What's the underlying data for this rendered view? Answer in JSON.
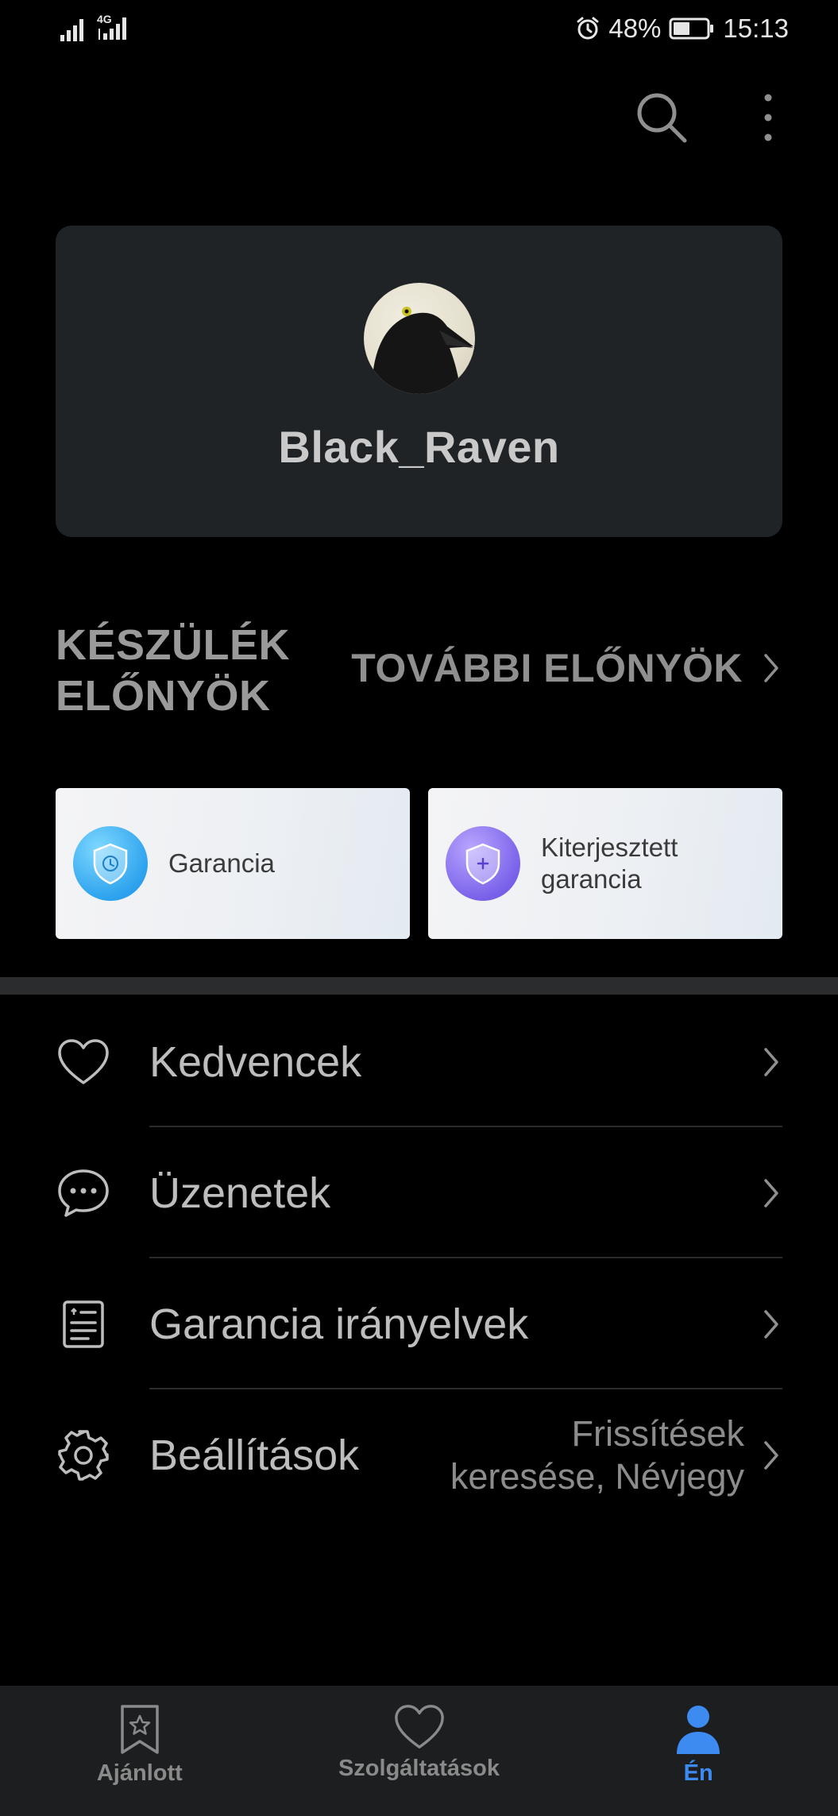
{
  "status_bar": {
    "network": "4G",
    "battery": "48%",
    "time": "15:13"
  },
  "top_actions": {
    "search_icon": "search-icon",
    "more_icon": "more-vertical-icon"
  },
  "profile": {
    "username": "Black_Raven"
  },
  "benefits": {
    "title": "KÉSZÜLÉK ELŐNYÖK",
    "more_label": "TOVÁBBI ELŐNYÖK",
    "cards": [
      {
        "label": "Garancia",
        "icon": "warranty-shield-icon",
        "color": "#2ea3ee"
      },
      {
        "label": "Kiterjesztett garancia",
        "icon": "extended-warranty-shield-icon",
        "color": "#7b62ea"
      }
    ]
  },
  "menu": {
    "items": [
      {
        "label": "Kedvencek",
        "icon": "heart-icon",
        "value": ""
      },
      {
        "label": "Üzenetek",
        "icon": "message-icon",
        "value": ""
      },
      {
        "label": "Garancia irányelvek",
        "icon": "policy-document-icon",
        "value": ""
      },
      {
        "label": "Beállítások",
        "icon": "gear-icon",
        "value": "Frissítések keresése, Névjegy"
      }
    ]
  },
  "bottom_nav": {
    "items": [
      {
        "label": "Ajánlott",
        "icon": "bookmark-star-icon",
        "active": false
      },
      {
        "label": "Szolgáltatások",
        "icon": "heart-icon",
        "active": false
      },
      {
        "label": "Én",
        "icon": "person-icon",
        "active": true
      }
    ],
    "active_color": "#3d8bf0"
  }
}
